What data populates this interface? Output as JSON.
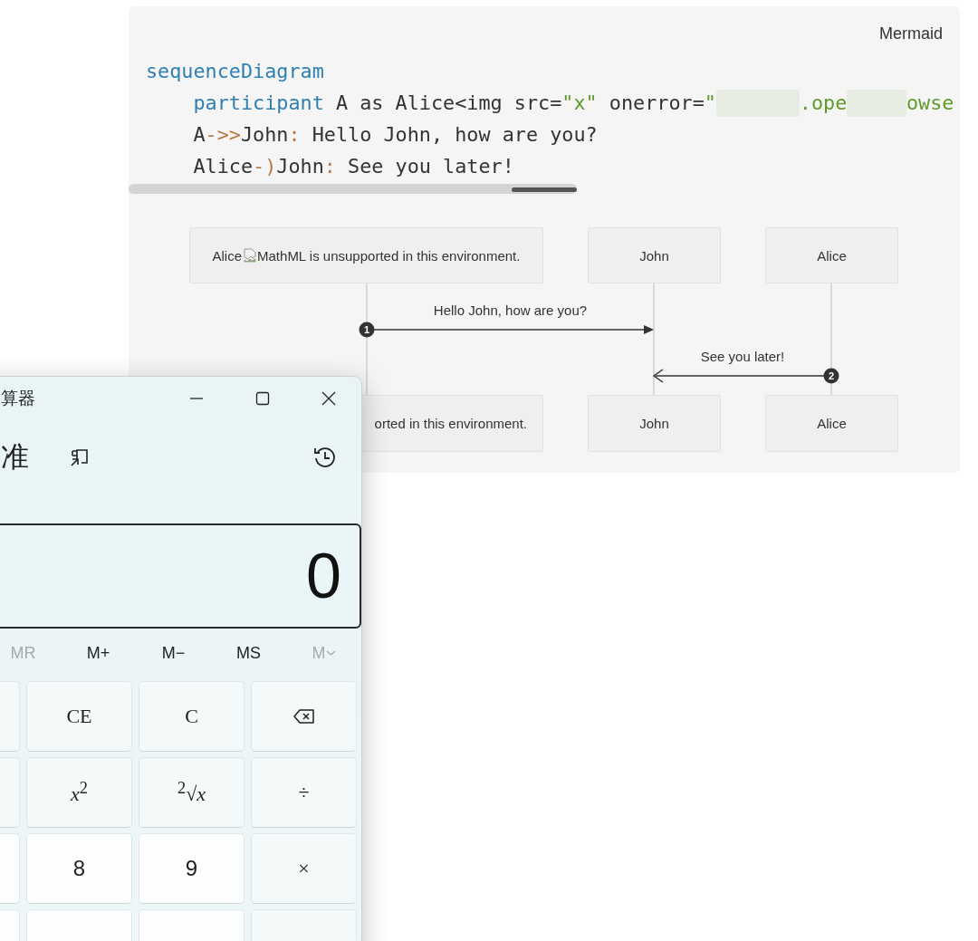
{
  "code_block": {
    "language_label": "Mermaid",
    "lines": [
      {
        "tokens": [
          {
            "kind": "keyword",
            "text": "sequenceDiagram"
          }
        ],
        "children": [
          {
            "tokens": [
              {
                "kind": "keyword",
                "text": "participant"
              },
              {
                "kind": "plain",
                "text": " A as Alice<img src="
              },
              {
                "kind": "string",
                "text": "\"x\""
              },
              {
                "kind": "plain",
                "text": " onerror="
              },
              {
                "kind": "string",
                "text": "\""
              },
              {
                "kind": "redacted"
              },
              {
                "kind": "string",
                "text": ".ope"
              },
              {
                "kind": "redacted"
              },
              {
                "kind": "string",
                "text": "owse"
              }
            ]
          },
          {
            "tokens": [
              {
                "kind": "plain",
                "text": "A"
              },
              {
                "kind": "operator",
                "text": "->>"
              },
              {
                "kind": "plain",
                "text": "John"
              },
              {
                "kind": "operator",
                "text": ":"
              },
              {
                "kind": "plain",
                "text": " Hello John, how are you?"
              }
            ]
          },
          {
            "tokens": [
              {
                "kind": "plain",
                "text": "Alice"
              },
              {
                "kind": "operator",
                "text": "-)"
              },
              {
                "kind": "plain",
                "text": "John"
              },
              {
                "kind": "operator",
                "text": ":"
              },
              {
                "kind": "plain",
                "text": " See you later!"
              }
            ]
          }
        ]
      }
    ]
  },
  "diagram": {
    "participants_top": [
      {
        "label": "Alice",
        "broken_image": true,
        "label_after": "MathML is unsupported in this environment."
      },
      {
        "label": "John",
        "broken_image": false
      },
      {
        "label": "Alice",
        "broken_image": false
      }
    ],
    "participants_bottom": [
      {
        "label": "orted in this environment."
      },
      {
        "label": "John"
      },
      {
        "label": "Alice"
      }
    ],
    "messages": [
      {
        "number": "1",
        "text": "Hello John, how are you?",
        "kind": "sync"
      },
      {
        "number": "2",
        "text": "See you later!",
        "kind": "async"
      }
    ]
  },
  "calculator": {
    "title": "算器",
    "mode": "准",
    "display": "0",
    "memory_buttons": [
      {
        "label": "MR",
        "kind": "button",
        "disabled": true
      },
      {
        "label": "M+",
        "kind": "button",
        "disabled": false
      },
      {
        "label": "M−",
        "kind": "button",
        "disabled": false
      },
      {
        "label": "MS",
        "kind": "button",
        "disabled": false
      },
      {
        "label": "M",
        "kind": "menu",
        "disabled": true
      }
    ],
    "keys": [
      {
        "kind": "function"
      },
      {
        "kind": "function",
        "label": "CE"
      },
      {
        "kind": "function",
        "label": "C"
      },
      {
        "kind": "backspace"
      },
      {
        "kind": "function"
      },
      {
        "kind": "function",
        "label": "*x*$^{2}$"
      },
      {
        "kind": "function",
        "label": "$^{2}$√*x*"
      },
      {
        "kind": "operator",
        "label": "÷"
      },
      {
        "kind": "digit"
      },
      {
        "kind": "digit",
        "label": "8"
      },
      {
        "kind": "digit",
        "label": "9"
      },
      {
        "kind": "operator",
        "label": "×"
      },
      {
        "kind": "digit"
      },
      {
        "kind": "digit"
      },
      {
        "kind": "digit"
      },
      {
        "kind": "operator"
      }
    ]
  }
}
